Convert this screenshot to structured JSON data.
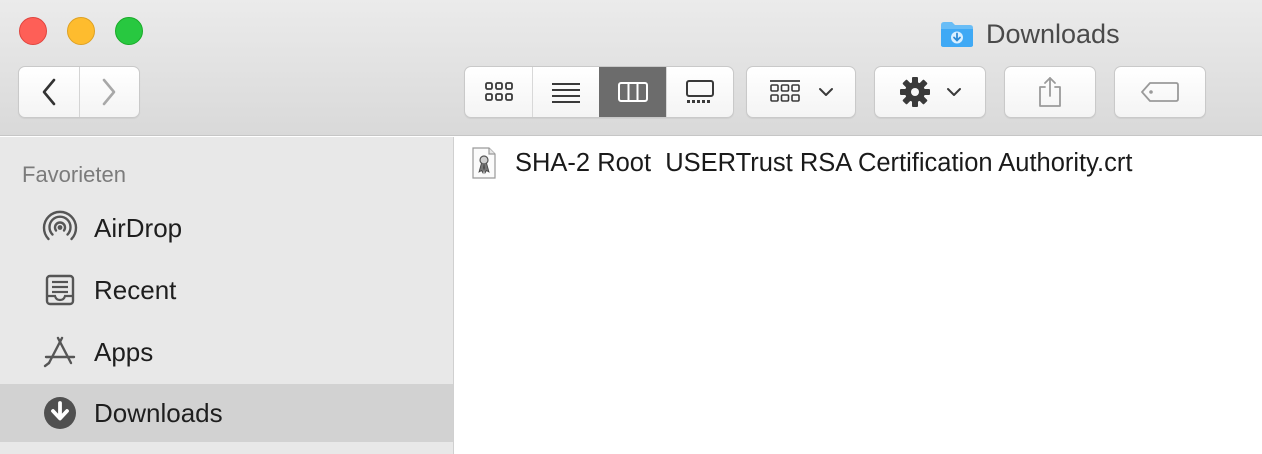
{
  "window": {
    "title": "Downloads"
  },
  "sidebar": {
    "section_title": "Favorieten",
    "items": [
      {
        "label": "AirDrop",
        "icon": "airdrop-icon"
      },
      {
        "label": "Recent",
        "icon": "recent-icon"
      },
      {
        "label": "Apps",
        "icon": "apps-icon"
      },
      {
        "label": "Downloads",
        "icon": "downloads-icon",
        "selected": true
      }
    ]
  },
  "files": [
    {
      "name": "SHA-2 Root  USERTrust RSA Certification Authority.crt",
      "icon": "certificate-file-icon"
    }
  ],
  "colors": {
    "accent_folder": "#3fa9f5",
    "selected_view": "#6c6c6c",
    "sidebar_bg": "#e8e8e8",
    "sidebar_selected": "#d2d2d2"
  }
}
